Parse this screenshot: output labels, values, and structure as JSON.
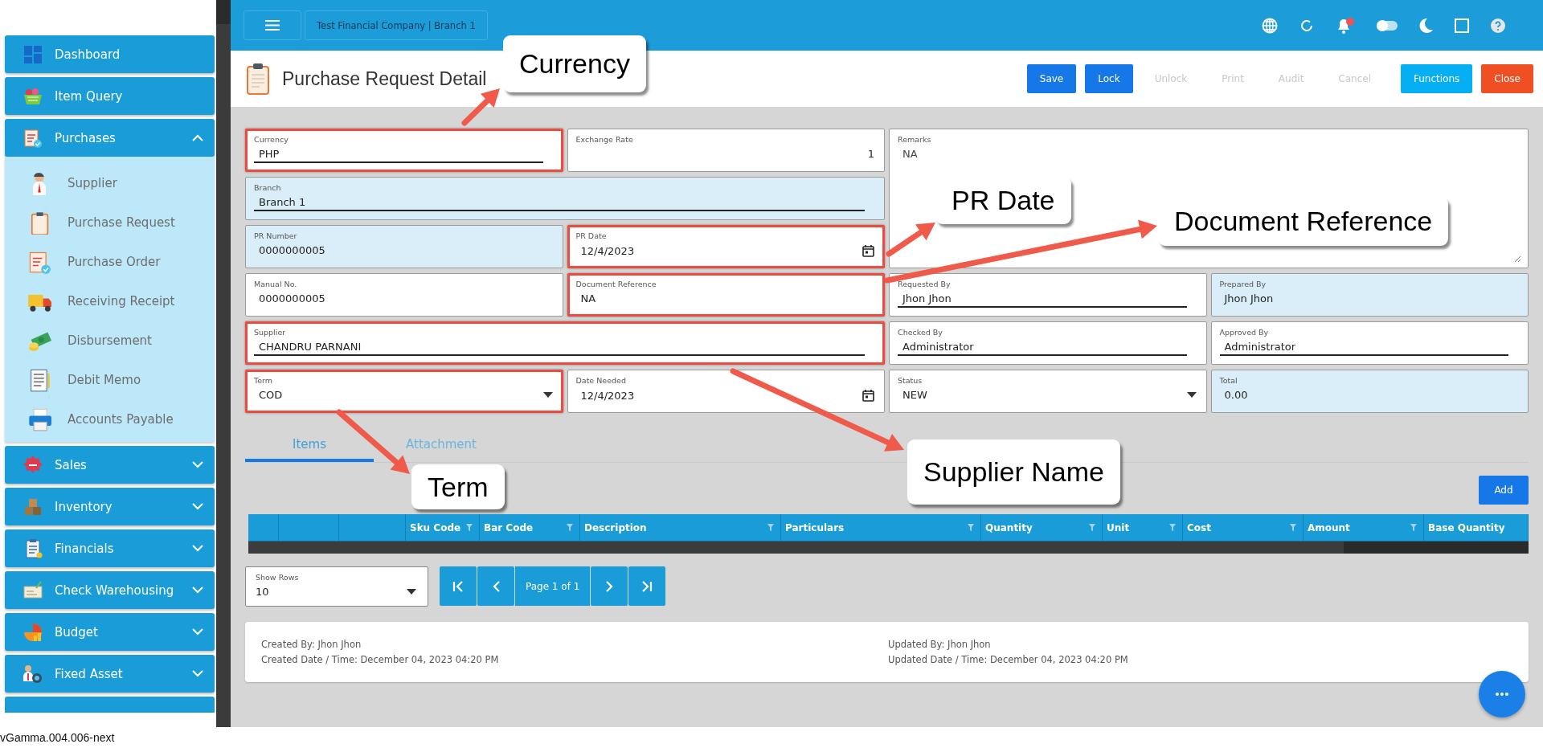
{
  "header": {
    "company": "Test Financial Company | Branch 1"
  },
  "sidebar": {
    "items": [
      {
        "label": "Dashboard",
        "kind": "link"
      },
      {
        "label": "Item Query",
        "kind": "link"
      },
      {
        "label": "Purchases",
        "kind": "group",
        "expanded": true,
        "children": [
          {
            "label": "Supplier"
          },
          {
            "label": "Purchase Request"
          },
          {
            "label": "Purchase Order"
          },
          {
            "label": "Receiving Receipt"
          },
          {
            "label": "Disbursement"
          },
          {
            "label": "Debit Memo"
          },
          {
            "label": "Accounts Payable"
          }
        ]
      },
      {
        "label": "Sales",
        "kind": "group",
        "expanded": false
      },
      {
        "label": "Inventory",
        "kind": "group",
        "expanded": false
      },
      {
        "label": "Financials",
        "kind": "group",
        "expanded": false
      },
      {
        "label": "Check Warehousing",
        "kind": "group",
        "expanded": false
      },
      {
        "label": "Budget",
        "kind": "group",
        "expanded": false
      },
      {
        "label": "Fixed Asset",
        "kind": "group",
        "expanded": false
      }
    ]
  },
  "page": {
    "title": "Purchase Request Detail"
  },
  "toolbar": [
    {
      "label": "Save",
      "kind": "primary",
      "disabled": false
    },
    {
      "label": "Lock",
      "kind": "primary",
      "disabled": false
    },
    {
      "label": "Unlock",
      "kind": "plain",
      "disabled": true
    },
    {
      "label": "Print",
      "kind": "plain",
      "disabled": true
    },
    {
      "label": "Audit",
      "kind": "plain",
      "disabled": true
    },
    {
      "label": "Cancel",
      "kind": "plain",
      "disabled": true
    },
    {
      "label": "Functions",
      "kind": "accent",
      "disabled": false
    },
    {
      "label": "Close",
      "kind": "danger",
      "disabled": false
    }
  ],
  "form": {
    "fields": [
      {
        "label": "Currency",
        "value": "PHP",
        "kind": "lookup",
        "readonly": false,
        "highlighted": true
      },
      {
        "label": "Exchange Rate",
        "value": "1",
        "kind": "number",
        "readonly": false,
        "highlighted": false
      },
      {
        "label": "Remarks",
        "value": "NA",
        "kind": "textarea",
        "readonly": false,
        "highlighted": false
      },
      {
        "label": "Branch",
        "value": "Branch 1",
        "kind": "lookup",
        "readonly": true,
        "highlighted": false
      },
      {
        "label": "PR Number",
        "value": "0000000005",
        "kind": "text",
        "readonly": true,
        "highlighted": false
      },
      {
        "label": "PR Date",
        "value": "12/4/2023",
        "kind": "date",
        "readonly": false,
        "highlighted": true
      },
      {
        "label": "Manual No.",
        "value": "0000000005",
        "kind": "text",
        "readonly": false,
        "highlighted": false
      },
      {
        "label": "Document Reference",
        "value": "NA",
        "kind": "text",
        "readonly": false,
        "highlighted": true
      },
      {
        "label": "Requested By",
        "value": "Jhon Jhon",
        "kind": "lookup",
        "readonly": false,
        "highlighted": false
      },
      {
        "label": "Prepared By",
        "value": "Jhon Jhon",
        "kind": "text",
        "readonly": true,
        "highlighted": false
      },
      {
        "label": "Supplier",
        "value": "CHANDRU PARNANI",
        "kind": "lookup",
        "readonly": false,
        "highlighted": true
      },
      {
        "label": "Checked By",
        "value": "Administrator",
        "kind": "lookup",
        "readonly": false,
        "highlighted": false
      },
      {
        "label": "Approved By",
        "value": "Administrator",
        "kind": "lookup",
        "readonly": false,
        "highlighted": false
      },
      {
        "label": "Term",
        "value": "COD",
        "kind": "select",
        "readonly": false,
        "highlighted": true
      },
      {
        "label": "Date Needed",
        "value": "12/4/2023",
        "kind": "date",
        "readonly": false,
        "highlighted": false
      },
      {
        "label": "Status",
        "value": "NEW",
        "kind": "select",
        "readonly": false,
        "highlighted": false
      },
      {
        "label": "Total",
        "value": "0.00",
        "kind": "text",
        "readonly": true,
        "highlighted": false
      }
    ]
  },
  "tabs": [
    {
      "label": "Items",
      "selected": true
    },
    {
      "label": "Attachment",
      "selected": false
    }
  ],
  "add_button": "Add",
  "table": {
    "columns": [
      "Sku Code",
      "Bar Code",
      "Description",
      "Particulars",
      "Quantity",
      "Unit",
      "Cost",
      "Amount",
      "Base Quantity"
    ]
  },
  "pager": {
    "show_rows": {
      "label": "Show Rows",
      "value": "10"
    },
    "page_label": "Page 1 of 1"
  },
  "audit_info": {
    "created_by": "Created By: Jhon Jhon",
    "created_date": "Created Date / Time: December 04, 2023 04:20 PM",
    "updated_by": "Updated By: Jhon Jhon",
    "updated_date": "Updated Date / Time: December 04, 2023 04:20 PM"
  },
  "version": "vGamma.004.006-next",
  "annotations": [
    {
      "text": "Currency"
    },
    {
      "text": "PR Date"
    },
    {
      "text": "Document Reference"
    },
    {
      "text": "Supplier Name"
    },
    {
      "text": "Term"
    }
  ]
}
